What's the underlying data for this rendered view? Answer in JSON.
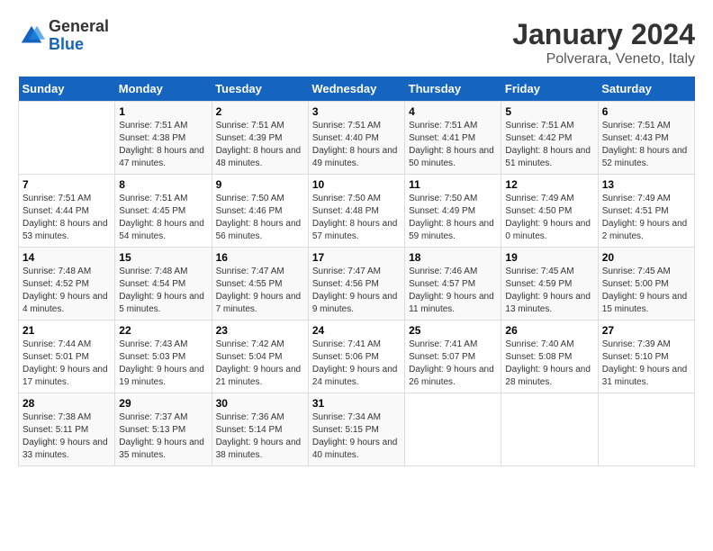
{
  "logo": {
    "general": "General",
    "blue": "Blue"
  },
  "title": "January 2024",
  "subtitle": "Polverara, Veneto, Italy",
  "days_of_week": [
    "Sunday",
    "Monday",
    "Tuesday",
    "Wednesday",
    "Thursday",
    "Friday",
    "Saturday"
  ],
  "weeks": [
    [
      {
        "day": null,
        "info": null
      },
      {
        "day": "1",
        "sunrise": "7:51 AM",
        "sunset": "4:38 PM",
        "daylight": "8 hours and 47 minutes."
      },
      {
        "day": "2",
        "sunrise": "7:51 AM",
        "sunset": "4:39 PM",
        "daylight": "8 hours and 48 minutes."
      },
      {
        "day": "3",
        "sunrise": "7:51 AM",
        "sunset": "4:40 PM",
        "daylight": "8 hours and 49 minutes."
      },
      {
        "day": "4",
        "sunrise": "7:51 AM",
        "sunset": "4:41 PM",
        "daylight": "8 hours and 50 minutes."
      },
      {
        "day": "5",
        "sunrise": "7:51 AM",
        "sunset": "4:42 PM",
        "daylight": "8 hours and 51 minutes."
      },
      {
        "day": "6",
        "sunrise": "7:51 AM",
        "sunset": "4:43 PM",
        "daylight": "8 hours and 52 minutes."
      }
    ],
    [
      {
        "day": "7",
        "sunrise": "7:51 AM",
        "sunset": "4:44 PM",
        "daylight": "8 hours and 53 minutes."
      },
      {
        "day": "8",
        "sunrise": "7:51 AM",
        "sunset": "4:45 PM",
        "daylight": "8 hours and 54 minutes."
      },
      {
        "day": "9",
        "sunrise": "7:50 AM",
        "sunset": "4:46 PM",
        "daylight": "8 hours and 56 minutes."
      },
      {
        "day": "10",
        "sunrise": "7:50 AM",
        "sunset": "4:48 PM",
        "daylight": "8 hours and 57 minutes."
      },
      {
        "day": "11",
        "sunrise": "7:50 AM",
        "sunset": "4:49 PM",
        "daylight": "8 hours and 59 minutes."
      },
      {
        "day": "12",
        "sunrise": "7:49 AM",
        "sunset": "4:50 PM",
        "daylight": "9 hours and 0 minutes."
      },
      {
        "day": "13",
        "sunrise": "7:49 AM",
        "sunset": "4:51 PM",
        "daylight": "9 hours and 2 minutes."
      }
    ],
    [
      {
        "day": "14",
        "sunrise": "7:48 AM",
        "sunset": "4:52 PM",
        "daylight": "9 hours and 4 minutes."
      },
      {
        "day": "15",
        "sunrise": "7:48 AM",
        "sunset": "4:54 PM",
        "daylight": "9 hours and 5 minutes."
      },
      {
        "day": "16",
        "sunrise": "7:47 AM",
        "sunset": "4:55 PM",
        "daylight": "9 hours and 7 minutes."
      },
      {
        "day": "17",
        "sunrise": "7:47 AM",
        "sunset": "4:56 PM",
        "daylight": "9 hours and 9 minutes."
      },
      {
        "day": "18",
        "sunrise": "7:46 AM",
        "sunset": "4:57 PM",
        "daylight": "9 hours and 11 minutes."
      },
      {
        "day": "19",
        "sunrise": "7:45 AM",
        "sunset": "4:59 PM",
        "daylight": "9 hours and 13 minutes."
      },
      {
        "day": "20",
        "sunrise": "7:45 AM",
        "sunset": "5:00 PM",
        "daylight": "9 hours and 15 minutes."
      }
    ],
    [
      {
        "day": "21",
        "sunrise": "7:44 AM",
        "sunset": "5:01 PM",
        "daylight": "9 hours and 17 minutes."
      },
      {
        "day": "22",
        "sunrise": "7:43 AM",
        "sunset": "5:03 PM",
        "daylight": "9 hours and 19 minutes."
      },
      {
        "day": "23",
        "sunrise": "7:42 AM",
        "sunset": "5:04 PM",
        "daylight": "9 hours and 21 minutes."
      },
      {
        "day": "24",
        "sunrise": "7:41 AM",
        "sunset": "5:06 PM",
        "daylight": "9 hours and 24 minutes."
      },
      {
        "day": "25",
        "sunrise": "7:41 AM",
        "sunset": "5:07 PM",
        "daylight": "9 hours and 26 minutes."
      },
      {
        "day": "26",
        "sunrise": "7:40 AM",
        "sunset": "5:08 PM",
        "daylight": "9 hours and 28 minutes."
      },
      {
        "day": "27",
        "sunrise": "7:39 AM",
        "sunset": "5:10 PM",
        "daylight": "9 hours and 31 minutes."
      }
    ],
    [
      {
        "day": "28",
        "sunrise": "7:38 AM",
        "sunset": "5:11 PM",
        "daylight": "9 hours and 33 minutes."
      },
      {
        "day": "29",
        "sunrise": "7:37 AM",
        "sunset": "5:13 PM",
        "daylight": "9 hours and 35 minutes."
      },
      {
        "day": "30",
        "sunrise": "7:36 AM",
        "sunset": "5:14 PM",
        "daylight": "9 hours and 38 minutes."
      },
      {
        "day": "31",
        "sunrise": "7:34 AM",
        "sunset": "5:15 PM",
        "daylight": "9 hours and 40 minutes."
      },
      {
        "day": null,
        "info": null
      },
      {
        "day": null,
        "info": null
      },
      {
        "day": null,
        "info": null
      }
    ]
  ],
  "labels": {
    "sunrise": "Sunrise:",
    "sunset": "Sunset:",
    "daylight": "Daylight:"
  }
}
